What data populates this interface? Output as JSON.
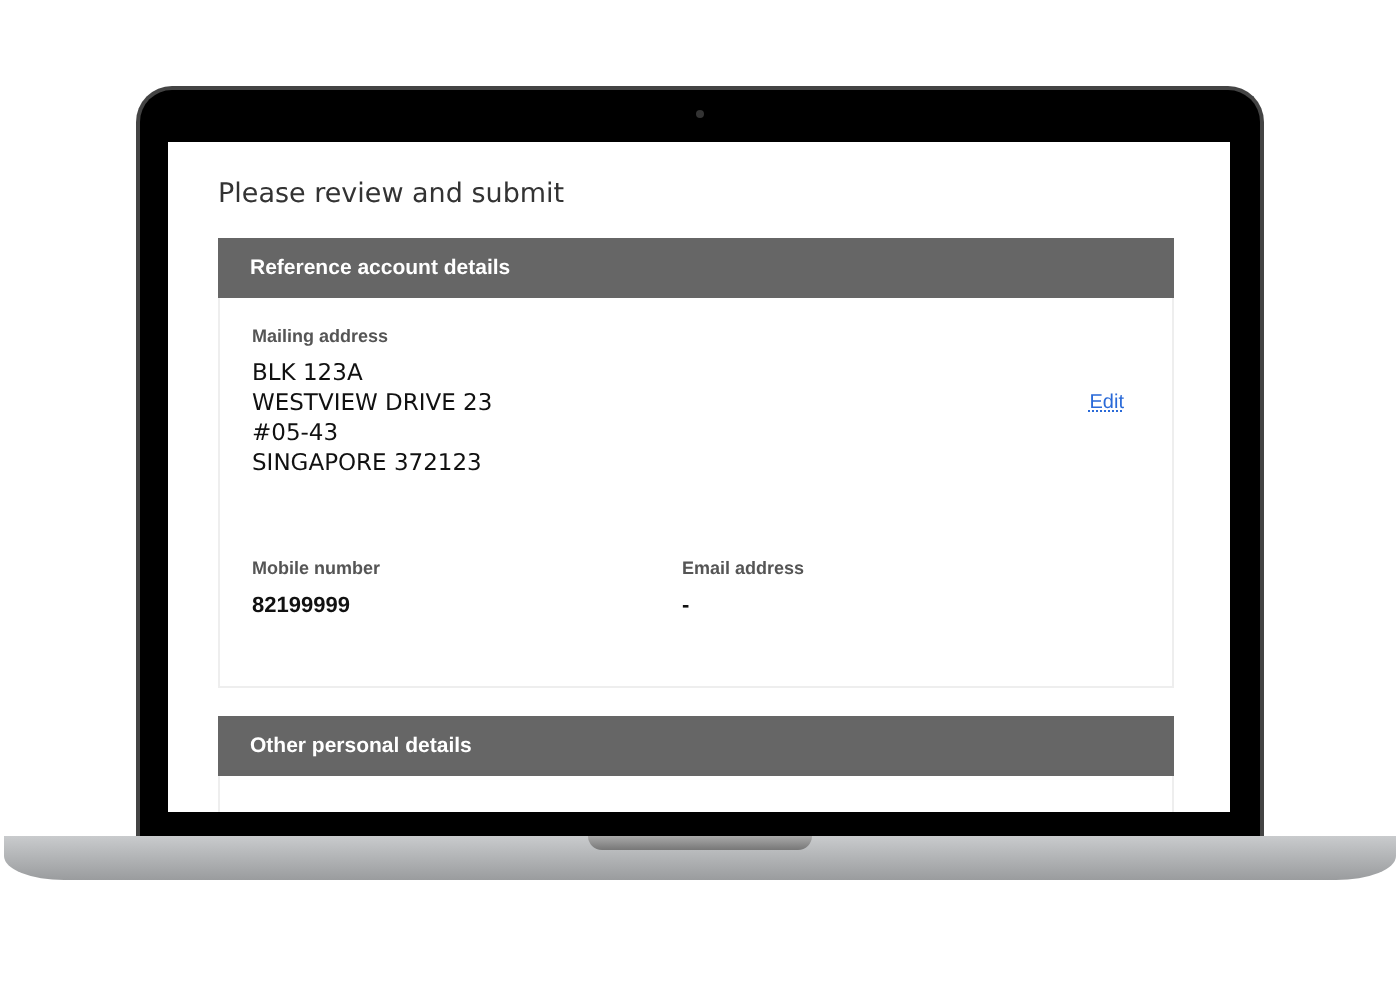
{
  "page": {
    "title": "Please review and submit"
  },
  "sections": [
    {
      "title": "Reference account details",
      "fields": [
        {
          "kind": "address",
          "label": "Mailing address",
          "lines": [
            "BLK 123A",
            "WESTVIEW DRIVE 23",
            "#05-43",
            "SINGAPORE 372123"
          ],
          "action": "Edit"
        },
        {
          "kind": "pair",
          "label": "Mobile number",
          "value": "82199999"
        },
        {
          "kind": "pair",
          "label": "Email address",
          "value": "-"
        }
      ]
    },
    {
      "title": "Other personal details"
    }
  ]
}
